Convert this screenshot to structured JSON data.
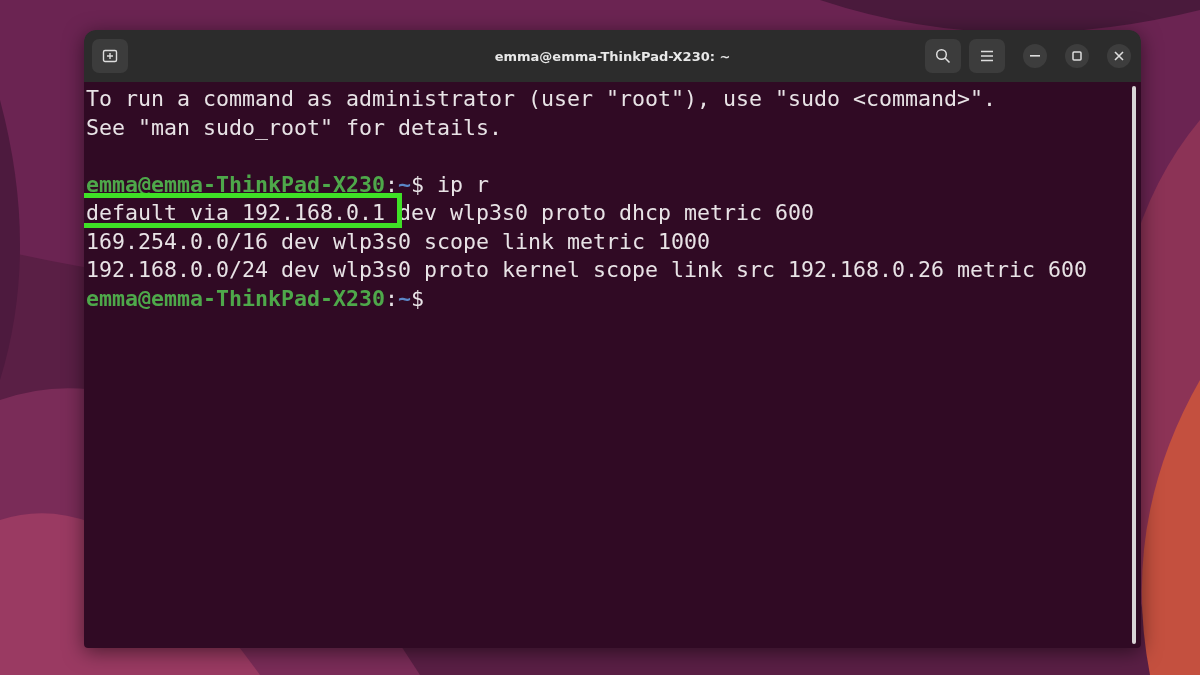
{
  "window": {
    "title": "emma@emma-ThinkPad-X230: ~"
  },
  "terminal": {
    "lines": [
      {
        "kind": "output",
        "segments": [
          {
            "text": "To run a command as administrator (user \"root\"), use \"sudo <command>\".",
            "highlighted": false
          }
        ]
      },
      {
        "kind": "output",
        "segments": [
          {
            "text": "See \"man sudo_root\" for details.",
            "highlighted": false
          }
        ]
      },
      {
        "kind": "blank"
      },
      {
        "kind": "prompt",
        "host": "emma@emma-ThinkPad-X230",
        "separator": ":",
        "path": "~",
        "symbol": "$",
        "command": "ip r"
      },
      {
        "kind": "output",
        "segments": [
          {
            "text": "default via 192.168.0.1",
            "highlighted": true
          },
          {
            "text": " dev wlp3s0 proto dhcp metric 600",
            "highlighted": false
          }
        ]
      },
      {
        "kind": "output",
        "segments": [
          {
            "text": "169.254.0.0/16 dev wlp3s0 scope link metric 1000",
            "highlighted": false
          }
        ]
      },
      {
        "kind": "output",
        "segments": [
          {
            "text": "192.168.0.0/24 dev wlp3s0 proto kernel scope link src 192.168.0.26 metric 600",
            "highlighted": false
          }
        ]
      },
      {
        "kind": "prompt",
        "host": "emma@emma-ThinkPad-X230",
        "separator": ":",
        "path": "~",
        "symbol": "$"
      }
    ]
  }
}
